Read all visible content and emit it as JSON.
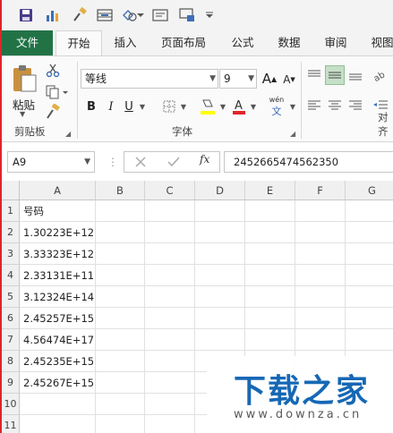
{
  "tabs": [
    {
      "label": "文件"
    },
    {
      "label": "开始"
    },
    {
      "label": "插入"
    },
    {
      "label": "页面布局"
    },
    {
      "label": "公式"
    },
    {
      "label": "数据"
    },
    {
      "label": "审阅"
    },
    {
      "label": "视图"
    }
  ],
  "ribbon": {
    "paste_label": "粘贴",
    "clipboard_group": "剪贴板",
    "font_name": "等线",
    "font_size": "9",
    "font_group": "字体",
    "align_group_partial": "对齐",
    "bold": "B",
    "italic": "I",
    "underline": "U",
    "grow_font": "A",
    "shrink_font": "A",
    "pinyin_top": "wén",
    "pinyin_bottom": "文"
  },
  "formula_bar": {
    "name_box": "A9",
    "fx": "fx",
    "formula": "2452665474562350"
  },
  "columns": [
    "A",
    "B",
    "C",
    "D",
    "E",
    "F",
    "G"
  ],
  "rows": [
    {
      "num": "1",
      "a": "号码"
    },
    {
      "num": "2",
      "a": "1.30223E+12"
    },
    {
      "num": "3",
      "a": "3.33323E+12"
    },
    {
      "num": "4",
      "a": "2.33131E+11"
    },
    {
      "num": "5",
      "a": "3.12324E+14"
    },
    {
      "num": "6",
      "a": "2.45257E+15"
    },
    {
      "num": "7",
      "a": "4.56474E+17"
    },
    {
      "num": "8",
      "a": "2.45235E+15"
    },
    {
      "num": "9",
      "a": "2.45267E+15"
    },
    {
      "num": "10",
      "a": ""
    },
    {
      "num": "11",
      "a": ""
    }
  ],
  "watermark": {
    "title": "下载之家",
    "url": "www.downza.cn"
  },
  "colors": {
    "file_tab": "#217346",
    "ribbon_bg": "#fafafa",
    "watermark_blue": "#1668b5"
  }
}
